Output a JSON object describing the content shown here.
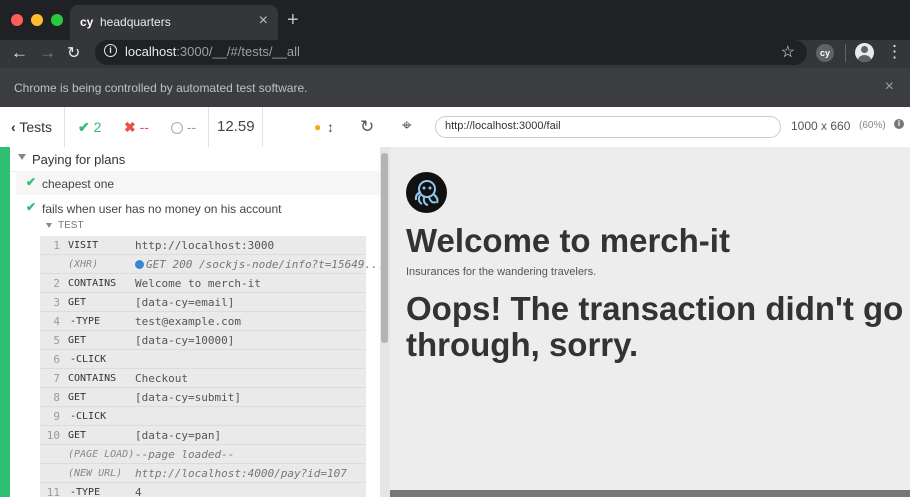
{
  "browser": {
    "tab_favicon": "cy",
    "tab_title": "headquarters",
    "tab_close": "×",
    "new_tab": "+",
    "url_host": "localhost",
    "url_rest": ":3000/__/#/tests/__all",
    "extension_label": "cy",
    "automation_message": "Chrome is being controlled by automated test software.",
    "automation_close": "×",
    "colors": {
      "frame": "#202124",
      "toolbar": "#35363a"
    }
  },
  "reporter": {
    "back_label": "Tests",
    "passed": "2",
    "failed": "--",
    "pending": "--",
    "duration": "12.59",
    "suite_title": "Paying for plans",
    "tests": [
      {
        "title": "cheapest one"
      },
      {
        "title": "fails when user has no money on his account"
      }
    ],
    "test_header": "TEST",
    "commands": [
      {
        "num": "1",
        "name": "VISIT",
        "msg": "http://localhost:3000"
      },
      {
        "num": "",
        "name": "(XHR)",
        "msg": "GET 200 /sockjs-node/info?t=15649..."
      },
      {
        "num": "2",
        "name": "CONTAINS",
        "msg": "Welcome to merch-it"
      },
      {
        "num": "3",
        "name": "GET",
        "msg": "[data-cy=email]"
      },
      {
        "num": "4",
        "name": "-TYPE",
        "msg": "test@example.com"
      },
      {
        "num": "5",
        "name": "GET",
        "msg": "[data-cy=10000]"
      },
      {
        "num": "6",
        "name": "-CLICK",
        "msg": ""
      },
      {
        "num": "7",
        "name": "CONTAINS",
        "msg": "Checkout"
      },
      {
        "num": "8",
        "name": "GET",
        "msg": "[data-cy=submit]"
      },
      {
        "num": "9",
        "name": "-CLICK",
        "msg": ""
      },
      {
        "num": "10",
        "name": "GET",
        "msg": "[data-cy=pan]"
      },
      {
        "num": "",
        "name": "(PAGE LOAD)",
        "msg": "--page loaded--"
      },
      {
        "num": "",
        "name": "(NEW URL)",
        "msg": "http://localhost:4000/pay?id=107"
      },
      {
        "num": "11",
        "name": "-TYPE",
        "msg": "4"
      }
    ],
    "colors": {
      "pass": "#2fbf71",
      "fail": "#e94f4f",
      "running": "#f5a623",
      "xhr": "#3a86d4"
    }
  },
  "aut": {
    "url": "http://localhost:3000/fail",
    "viewport_size": "1000 x 660",
    "scale": "(60%)",
    "page": {
      "heading": "Welcome to merch-it",
      "subtitle": "Insurances for the wandering travelers.",
      "message": "Oops! The transaction didn't go through, sorry."
    }
  }
}
